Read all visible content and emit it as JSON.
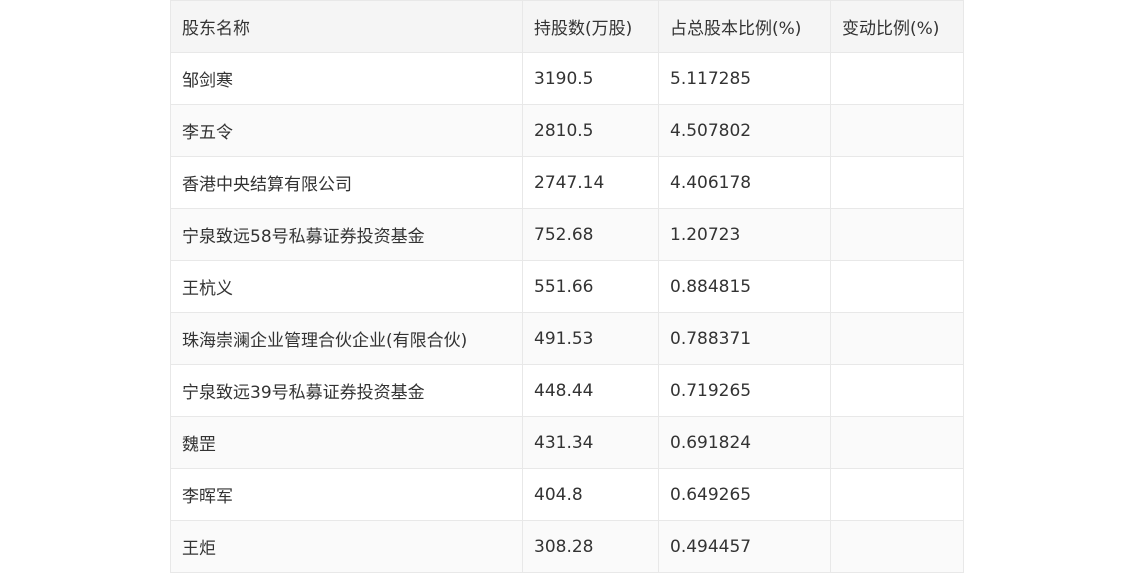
{
  "table": {
    "headers": [
      "股东名称",
      "持股数(万股)",
      "占总股本比例(%)",
      "变动比例(%)"
    ],
    "rows": [
      [
        "邹剑寒",
        "3190.5",
        "5.117285",
        ""
      ],
      [
        "李五令",
        "2810.5",
        "4.507802",
        ""
      ],
      [
        "香港中央结算有限公司",
        "2747.14",
        "4.406178",
        ""
      ],
      [
        "宁泉致远58号私募证券投资基金",
        "752.68",
        "1.20723",
        ""
      ],
      [
        "王杭义",
        "551.66",
        "0.884815",
        ""
      ],
      [
        "珠海崇澜企业管理合伙企业(有限合伙)",
        "491.53",
        "0.788371",
        ""
      ],
      [
        "宁泉致远39号私募证券投资基金",
        "448.44",
        "0.719265",
        ""
      ],
      [
        "魏罡",
        "431.34",
        "0.691824",
        ""
      ],
      [
        "李晖军",
        "404.8",
        "0.649265",
        ""
      ],
      [
        "王炬",
        "308.28",
        "0.494457",
        ""
      ]
    ]
  }
}
